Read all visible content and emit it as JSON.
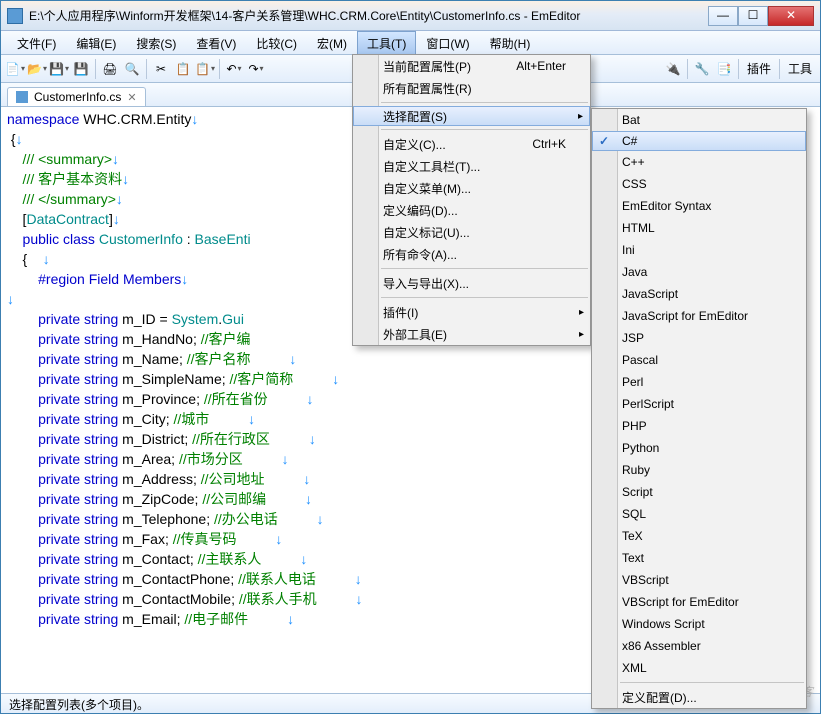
{
  "window": {
    "title": "E:\\个人应用程序\\Winform开发框架\\14-客户关系管理\\WHC.CRM.Core\\Entity\\CustomerInfo.cs - EmEditor"
  },
  "menubar": [
    "文件(F)",
    "编辑(E)",
    "搜索(S)",
    "查看(V)",
    "比较(C)",
    "宏(M)",
    "工具(T)",
    "窗口(W)",
    "帮助(H)"
  ],
  "menubar_open_index": 6,
  "toolbar_right": [
    "插件",
    "工具"
  ],
  "tab": {
    "label": "CustomerInfo.cs"
  },
  "statusbar": "选择配置列表(多个项目)。",
  "watermark": "@51CTO博客",
  "menu1": [
    {
      "label": "当前配置属性(P)",
      "shortcut": "Alt+Enter"
    },
    {
      "label": "所有配置属性(R)"
    },
    {
      "sep": true
    },
    {
      "label": "选择配置(S)",
      "sub": true,
      "hl": true
    },
    {
      "sep": true
    },
    {
      "label": "自定义(C)...",
      "shortcut": "Ctrl+K"
    },
    {
      "label": "自定义工具栏(T)..."
    },
    {
      "label": "自定义菜单(M)..."
    },
    {
      "label": "定义编码(D)..."
    },
    {
      "label": "自定义标记(U)..."
    },
    {
      "label": "所有命令(A)..."
    },
    {
      "sep": true
    },
    {
      "label": "导入与导出(X)..."
    },
    {
      "sep": true
    },
    {
      "label": "插件(I)",
      "sub": true
    },
    {
      "label": "外部工具(E)",
      "sub": true
    }
  ],
  "menu2": [
    {
      "label": "Bat"
    },
    {
      "label": "C#",
      "check": true,
      "hl": true
    },
    {
      "label": "C++"
    },
    {
      "label": "CSS"
    },
    {
      "label": "EmEditor Syntax"
    },
    {
      "label": "HTML"
    },
    {
      "label": "Ini"
    },
    {
      "label": "Java"
    },
    {
      "label": "JavaScript"
    },
    {
      "label": "JavaScript for EmEditor"
    },
    {
      "label": "JSP"
    },
    {
      "label": "Pascal"
    },
    {
      "label": "Perl"
    },
    {
      "label": "PerlScript"
    },
    {
      "label": "PHP"
    },
    {
      "label": "Python"
    },
    {
      "label": "Ruby"
    },
    {
      "label": "Script"
    },
    {
      "label": "SQL"
    },
    {
      "label": "TeX"
    },
    {
      "label": "Text"
    },
    {
      "label": "VBScript"
    },
    {
      "label": "VBScript for EmEditor"
    },
    {
      "label": "Windows Script"
    },
    {
      "label": "x86 Assembler"
    },
    {
      "label": "XML"
    },
    {
      "sep": true
    },
    {
      "label": "定义配置(D)..."
    }
  ],
  "code_lines": [
    {
      "segs": [
        {
          "t": "namespace ",
          "c": "kw"
        },
        {
          "t": "WHC.CRM.Entity",
          "c": ""
        },
        {
          "t": "↓",
          "c": "ws"
        }
      ]
    },
    {
      "segs": [
        {
          "t": " {",
          "c": ""
        },
        {
          "t": "↓",
          "c": "ws"
        }
      ]
    },
    {
      "segs": [
        {
          "t": "    /// <summary>",
          "c": "cmt"
        },
        {
          "t": "↓",
          "c": "ws"
        }
      ]
    },
    {
      "segs": [
        {
          "t": "    /// 客户基本资料",
          "c": "cmt"
        },
        {
          "t": "↓",
          "c": "ws"
        }
      ]
    },
    {
      "segs": [
        {
          "t": "    /// </summary>",
          "c": "cmt"
        },
        {
          "t": "↓",
          "c": "ws"
        }
      ]
    },
    {
      "segs": [
        {
          "t": "    [",
          "c": ""
        },
        {
          "t": "DataContract",
          "c": "typ"
        },
        {
          "t": "]",
          "c": ""
        },
        {
          "t": "↓",
          "c": "ws"
        }
      ]
    },
    {
      "segs": [
        {
          "t": "    public class ",
          "c": "kw"
        },
        {
          "t": "CustomerInfo",
          "c": "typ"
        },
        {
          "t": " : ",
          "c": ""
        },
        {
          "t": "BaseEnti",
          "c": "typ"
        }
      ]
    },
    {
      "segs": [
        {
          "t": "    {    ",
          "c": ""
        },
        {
          "t": "↓",
          "c": "ws"
        }
      ]
    },
    {
      "segs": [
        {
          "t": "        #region Field Members",
          "c": "reg"
        },
        {
          "t": "↓",
          "c": "ws"
        }
      ]
    },
    {
      "segs": [
        {
          "t": "↓",
          "c": "ws"
        }
      ]
    },
    {
      "segs": [
        {
          "t": "        private string ",
          "c": "kw"
        },
        {
          "t": "m_ID = ",
          "c": ""
        },
        {
          "t": "System",
          "c": "typ"
        },
        {
          "t": ".",
          "c": ""
        },
        {
          "t": "Gui",
          "c": "typ"
        }
      ]
    },
    {
      "segs": [
        {
          "t": "        private string ",
          "c": "kw"
        },
        {
          "t": "m_HandNo; ",
          "c": ""
        },
        {
          "t": "//客户编",
          "c": "cmt"
        }
      ]
    },
    {
      "segs": [
        {
          "t": "        private string ",
          "c": "kw"
        },
        {
          "t": "m_Name; ",
          "c": ""
        },
        {
          "t": "//客户名称",
          "c": "cmt"
        },
        {
          "t": "          ↓",
          "c": "ws"
        }
      ]
    },
    {
      "segs": [
        {
          "t": "        private string ",
          "c": "kw"
        },
        {
          "t": "m_SimpleName; ",
          "c": ""
        },
        {
          "t": "//客户简称",
          "c": "cmt"
        },
        {
          "t": "          ↓",
          "c": "ws"
        }
      ]
    },
    {
      "segs": [
        {
          "t": "        private string ",
          "c": "kw"
        },
        {
          "t": "m_Province; ",
          "c": ""
        },
        {
          "t": "//所在省份",
          "c": "cmt"
        },
        {
          "t": "          ↓",
          "c": "ws"
        }
      ]
    },
    {
      "segs": [
        {
          "t": "        private string ",
          "c": "kw"
        },
        {
          "t": "m_City; ",
          "c": ""
        },
        {
          "t": "//城市",
          "c": "cmt"
        },
        {
          "t": "          ↓",
          "c": "ws"
        }
      ]
    },
    {
      "segs": [
        {
          "t": "        private string ",
          "c": "kw"
        },
        {
          "t": "m_District; ",
          "c": ""
        },
        {
          "t": "//所在行政区",
          "c": "cmt"
        },
        {
          "t": "          ↓",
          "c": "ws"
        }
      ]
    },
    {
      "segs": [
        {
          "t": "        private string ",
          "c": "kw"
        },
        {
          "t": "m_Area; ",
          "c": ""
        },
        {
          "t": "//市场分区",
          "c": "cmt"
        },
        {
          "t": "          ↓",
          "c": "ws"
        }
      ]
    },
    {
      "segs": [
        {
          "t": "        private string ",
          "c": "kw"
        },
        {
          "t": "m_Address; ",
          "c": ""
        },
        {
          "t": "//公司地址",
          "c": "cmt"
        },
        {
          "t": "          ↓",
          "c": "ws"
        }
      ]
    },
    {
      "segs": [
        {
          "t": "        private string ",
          "c": "kw"
        },
        {
          "t": "m_ZipCode; ",
          "c": ""
        },
        {
          "t": "//公司邮编",
          "c": "cmt"
        },
        {
          "t": "          ↓",
          "c": "ws"
        }
      ]
    },
    {
      "segs": [
        {
          "t": "        private string ",
          "c": "kw"
        },
        {
          "t": "m_Telephone; ",
          "c": ""
        },
        {
          "t": "//办公电话",
          "c": "cmt"
        },
        {
          "t": "          ↓",
          "c": "ws"
        }
      ]
    },
    {
      "segs": [
        {
          "t": "        private string ",
          "c": "kw"
        },
        {
          "t": "m_Fax; ",
          "c": ""
        },
        {
          "t": "//传真号码",
          "c": "cmt"
        },
        {
          "t": "          ↓",
          "c": "ws"
        }
      ]
    },
    {
      "segs": [
        {
          "t": "        private string ",
          "c": "kw"
        },
        {
          "t": "m_Contact; ",
          "c": ""
        },
        {
          "t": "//主联系人",
          "c": "cmt"
        },
        {
          "t": "          ↓",
          "c": "ws"
        }
      ]
    },
    {
      "segs": [
        {
          "t": "        private string ",
          "c": "kw"
        },
        {
          "t": "m_ContactPhone; ",
          "c": ""
        },
        {
          "t": "//联系人电话",
          "c": "cmt"
        },
        {
          "t": "          ↓",
          "c": "ws"
        }
      ]
    },
    {
      "segs": [
        {
          "t": "        private string ",
          "c": "kw"
        },
        {
          "t": "m_ContactMobile; ",
          "c": ""
        },
        {
          "t": "//联系人手机",
          "c": "cmt"
        },
        {
          "t": "          ↓",
          "c": "ws"
        }
      ]
    },
    {
      "segs": [
        {
          "t": "        private string ",
          "c": "kw"
        },
        {
          "t": "m_Email; ",
          "c": ""
        },
        {
          "t": "//电子邮件",
          "c": "cmt"
        },
        {
          "t": "          ↓",
          "c": "ws"
        }
      ]
    }
  ]
}
